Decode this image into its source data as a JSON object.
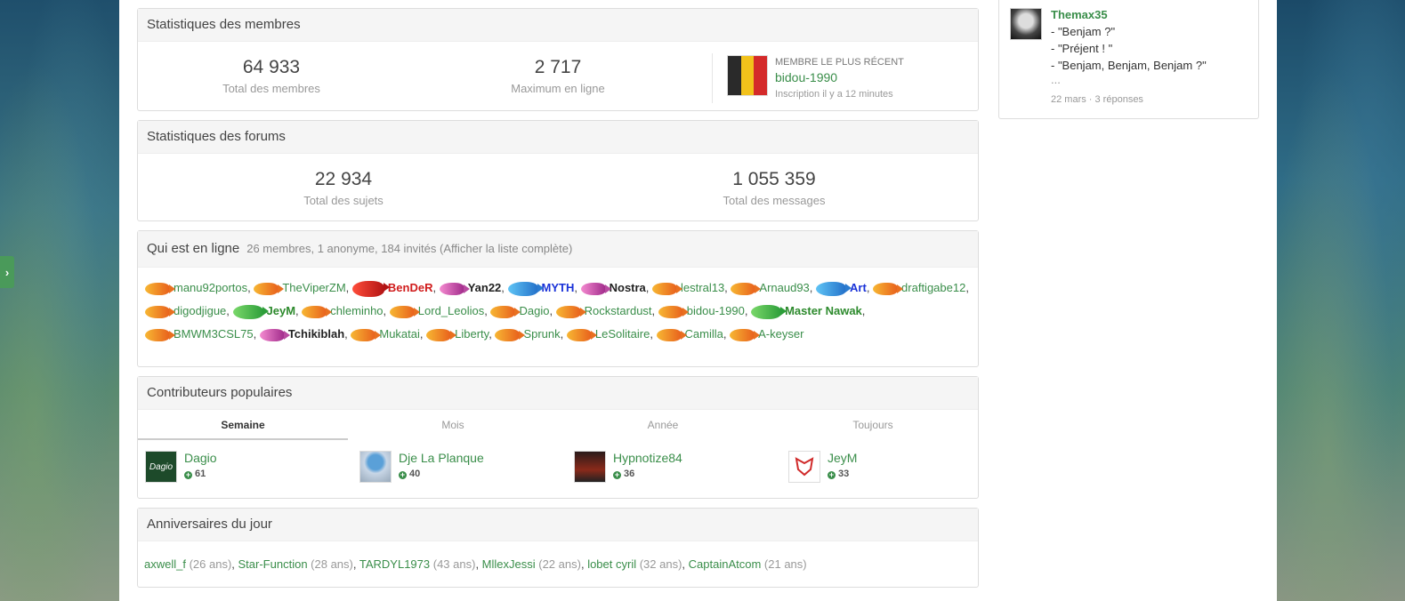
{
  "sidebar_card": {
    "author": "Themax35",
    "lines": [
      "- \"Benjam ?\"",
      "- \"Préjent ! \"",
      "- \"Benjam, Benjam, Benjam ?\"",
      "..."
    ],
    "meta": "22 mars · 3 réponses"
  },
  "members_stats": {
    "title": "Statistiques des membres",
    "total_value": "64 933",
    "total_label": "Total des membres",
    "max_value": "2 717",
    "max_label": "Maximum en ligne",
    "newest_caption": "Membre le plus récent",
    "newest_name": "bidou-1990",
    "newest_when": "Inscription il y a 12 minutes"
  },
  "forum_stats": {
    "title": "Statistiques des forums",
    "topics_value": "22 934",
    "topics_label": "Total des sujets",
    "messages_value": "1 055 359",
    "messages_label": "Total des messages"
  },
  "online": {
    "title": "Qui est en ligne",
    "summary": "26 membres, 1 anonyme, 184 invités (Afficher la liste complète)",
    "users": [
      {
        "name": "manu92portos",
        "role": "member",
        "icon": "goldfish-icon"
      },
      {
        "name": "TheViperZM",
        "role": "member",
        "icon": "goldfish-icon"
      },
      {
        "name": "BenDeR",
        "role": "red",
        "icon": "red-fish-icon"
      },
      {
        "name": "Yan22",
        "role": "black",
        "icon": "pink-fish-icon"
      },
      {
        "name": "MYTH",
        "role": "blue",
        "icon": "blue-fish-icon"
      },
      {
        "name": "Nostra",
        "role": "black",
        "icon": "pink-fish-icon"
      },
      {
        "name": "lestral13",
        "role": "member",
        "icon": "goldfish-icon"
      },
      {
        "name": "Arnaud93",
        "role": "member",
        "icon": "goldfish-icon"
      },
      {
        "name": "Art",
        "role": "blue",
        "icon": "blue-fish-icon"
      },
      {
        "name": "draftigabe12",
        "role": "member",
        "icon": "goldfish-icon"
      },
      {
        "name": "digodjigue",
        "role": "member",
        "icon": "goldfish-icon"
      },
      {
        "name": "JeyM",
        "role": "green",
        "icon": "green-fish-icon"
      },
      {
        "name": "chleminho",
        "role": "member",
        "icon": "goldfish-icon"
      },
      {
        "name": "Lord_Leolios",
        "role": "member",
        "icon": "goldfish-icon"
      },
      {
        "name": "Dagio",
        "role": "member",
        "icon": "goldfish-icon"
      },
      {
        "name": "Rockstardust",
        "role": "member",
        "icon": "goldfish-icon"
      },
      {
        "name": "bidou-1990",
        "role": "member",
        "icon": "goldfish-icon"
      },
      {
        "name": "Master Nawak",
        "role": "green",
        "icon": "green-fish-icon"
      },
      {
        "name": "BMWM3CSL75",
        "role": "member",
        "icon": "goldfish-icon"
      },
      {
        "name": "Tchikiblah",
        "role": "black",
        "icon": "pink-fish-icon"
      },
      {
        "name": "Mukatai",
        "role": "member",
        "icon": "goldfish-icon"
      },
      {
        "name": "Liberty",
        "role": "member",
        "icon": "goldfish-icon"
      },
      {
        "name": "Sprunk",
        "role": "member",
        "icon": "goldfish-icon"
      },
      {
        "name": "LeSolitaire",
        "role": "member",
        "icon": "goldfish-icon"
      },
      {
        "name": "Camilla",
        "role": "member",
        "icon": "goldfish-icon"
      },
      {
        "name": "A-keyser",
        "role": "member",
        "icon": "goldfish-icon"
      }
    ]
  },
  "contributors": {
    "title": "Contributeurs populaires",
    "tabs": [
      "Semaine",
      "Mois",
      "Année",
      "Toujours"
    ],
    "active_tab": "Semaine",
    "items": [
      {
        "name": "Dagio",
        "score": "61"
      },
      {
        "name": "Dje La Planque",
        "score": "40"
      },
      {
        "name": "Hypnotize84",
        "score": "36"
      },
      {
        "name": "JeyM",
        "score": "33"
      }
    ]
  },
  "birthdays": {
    "title": "Anniversaires du jour",
    "items": [
      {
        "name": "axwell_f",
        "age": "(26 ans)"
      },
      {
        "name": "Star-Function",
        "age": "(28 ans)"
      },
      {
        "name": "TARDYL1973",
        "age": "(43 ans)"
      },
      {
        "name": "MllexJessi",
        "age": "(22 ans)"
      },
      {
        "name": "lobet cyril",
        "age": "(32 ans)"
      },
      {
        "name": "CaptainAtcom",
        "age": "(21 ans)"
      }
    ]
  },
  "colors": {
    "link_green": "#3a8e4a",
    "role_red": "#d01c1c",
    "role_blue": "#1a32d8",
    "role_green": "#2d8a2d"
  }
}
